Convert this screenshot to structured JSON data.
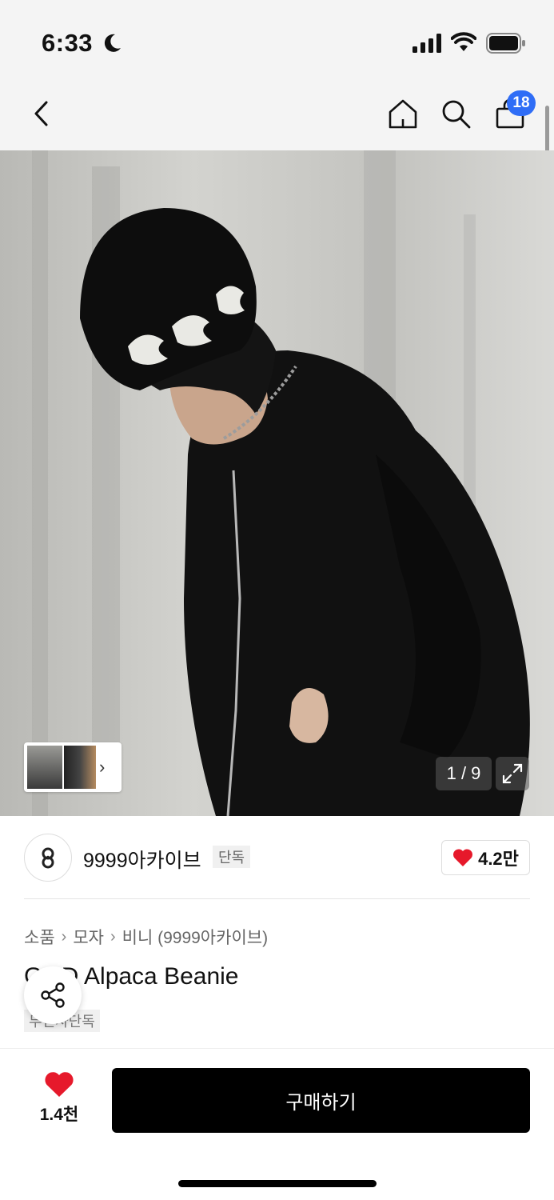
{
  "status_bar": {
    "time": "6:33",
    "icons": [
      "moon-icon",
      "signal-icon",
      "wifi-icon",
      "battery-icon"
    ]
  },
  "nav": {
    "icons": [
      "chevron-left-icon",
      "home-icon",
      "search-icon",
      "shopping-bag-icon"
    ],
    "cart_badge": "18"
  },
  "hero": {
    "page_counter": "1 / 9",
    "thumbnail_strip_icon": "chevron-right-icon",
    "expand_icon": "expand-icon"
  },
  "brand": {
    "name": "9999아카이브",
    "badge": "단독",
    "like_count": "4.2만",
    "like_icon": "heart-icon"
  },
  "breadcrumb": [
    "소품",
    "모자",
    "비니 (9999아카이브)"
  ],
  "product": {
    "title": "GOD Alpaca Beanie",
    "tag": "무신사단독",
    "share_icon": "share-icon"
  },
  "bottom_bar": {
    "wish_count": "1.4천",
    "buy_label": "구매하기"
  },
  "colors": {
    "accent_blue": "#2f6df6",
    "heart_red": "#e6192b",
    "buy_button": "#000000"
  }
}
